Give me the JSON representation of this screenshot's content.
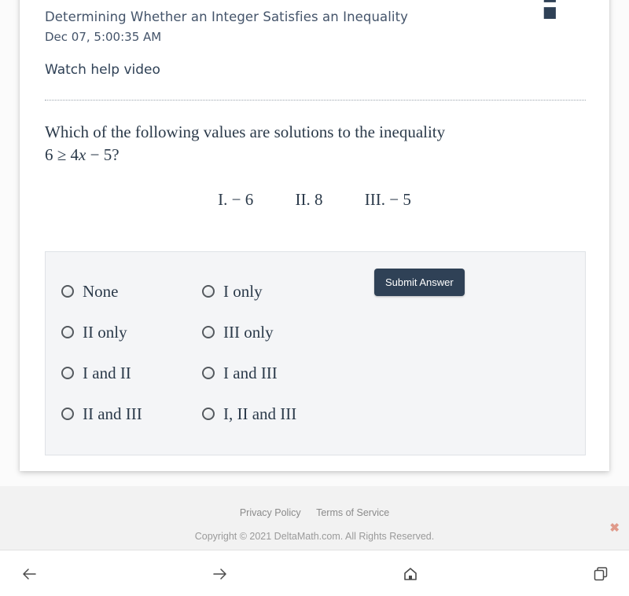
{
  "header": {
    "title": "Determining Whether an Integer Satisfies an Inequality",
    "date": "Dec 07, 5:00:35 AM",
    "help_video_label": "Watch help video",
    "help_icon": "question-mark-icon"
  },
  "question": {
    "prompt": "Which of the following values are solutions to the inequality",
    "math_prefix": "6 ≥ 4",
    "math_var": "x",
    "math_suffix": " − 5?",
    "choices_row": [
      "I. − 6",
      "II. 8",
      "III. − 5"
    ]
  },
  "answers": {
    "column1": [
      {
        "label": "None",
        "selected": false
      },
      {
        "label": "II only",
        "selected": false
      },
      {
        "label": "I and II",
        "selected": false
      },
      {
        "label": "II and III",
        "selected": false
      }
    ],
    "column2": [
      {
        "label": "I only",
        "selected": false
      },
      {
        "label": "III only",
        "selected": false
      },
      {
        "label": "I and III",
        "selected": false
      },
      {
        "label": "I, II and III",
        "selected": false
      }
    ],
    "submit_label": "Submit Answer",
    "submit_color": "#2f4156"
  },
  "footer": {
    "privacy_label": "Privacy Policy",
    "terms_label": "Terms of Service",
    "copyright": "Copyright © 2021 DeltaMath.com. All Rights Reserved.",
    "close_glyph": "✖",
    "close_color": "#e09a8a"
  },
  "navbar": {
    "back": "back-arrow-icon",
    "forward": "forward-arrow-icon",
    "home": "home-icon",
    "tabs": "tabs-icon"
  }
}
